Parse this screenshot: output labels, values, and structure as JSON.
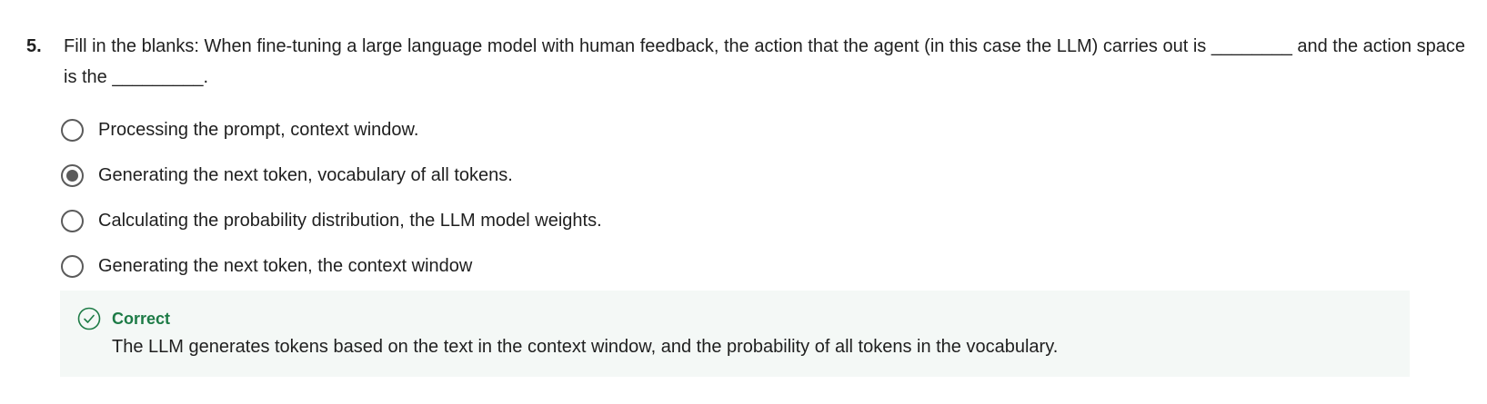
{
  "question": {
    "number": "5.",
    "text": "Fill in the blanks: When fine-tuning a large language model with human feedback, the action that the agent (in this case the LLM) carries out is ________ and the action space is the _________."
  },
  "options": [
    {
      "label": "Processing the prompt, context window.",
      "selected": false
    },
    {
      "label": "Generating the next token, vocabulary of all tokens.",
      "selected": true
    },
    {
      "label": "Calculating the probability distribution, the LLM model weights.",
      "selected": false
    },
    {
      "label": "Generating the next token, the context window",
      "selected": false
    }
  ],
  "feedback": {
    "status": "Correct",
    "message": "The LLM generates tokens based on the text in the context window, and the probability of all tokens in the vocabulary.",
    "icon": "check-circle-icon",
    "accent_color": "#1d7b46"
  }
}
